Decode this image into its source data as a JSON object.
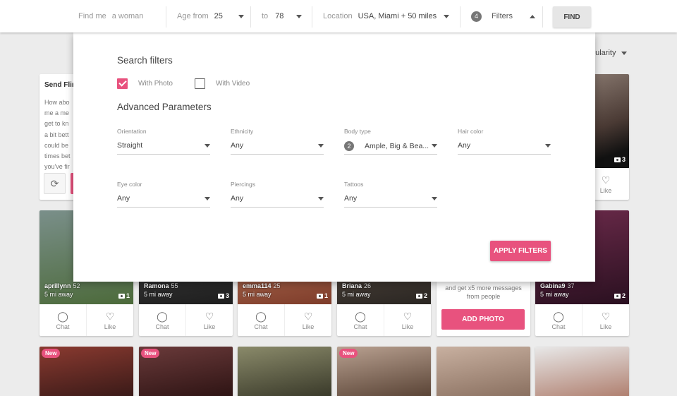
{
  "search": {
    "find_me_label": "Find me",
    "find_me_value": "a woman",
    "age_from_label": "Age from",
    "age_from_value": "25",
    "age_to_label": "to",
    "age_to_value": "78",
    "location_label": "Location",
    "location_value": "USA, Miami + 50 miles",
    "filters_count": "4",
    "filters_label": "Filters",
    "find_button": "FIND"
  },
  "sort": {
    "label": "pularity"
  },
  "flirt_card": {
    "title": "Send Flir",
    "lines": [
      "How abo",
      "me a me",
      "get to kn",
      "a bit bett",
      "could be",
      "times bet",
      "you've fir"
    ],
    "refresh_icon": "⟳"
  },
  "row1_right": {
    "photo_count": "3",
    "like_label": "Like"
  },
  "profiles": [
    {
      "name": "aprillynn",
      "age": "52",
      "distance": "5 mi away",
      "photos": "1",
      "colors": [
        "#7a8f8a",
        "#4c6a3a"
      ]
    },
    {
      "name": "Ramona",
      "age": "55",
      "distance": "5 mi away",
      "photos": "3",
      "colors": [
        "#4a4a4a",
        "#1e1e1e"
      ]
    },
    {
      "name": "emma114",
      "age": "25",
      "distance": "5 mi away",
      "photos": "1",
      "colors": [
        "#c98a6a",
        "#7e3c2a"
      ]
    },
    {
      "name": "Briana",
      "age": "26",
      "distance": "5 mi away",
      "photos": "2",
      "colors": [
        "#6a5a50",
        "#2a2622"
      ]
    },
    {
      "name": "Gabina9",
      "age": "37",
      "distance": "5 mi away",
      "photos": "2",
      "colors": [
        "#6b2a4a",
        "#2a1020"
      ]
    }
  ],
  "promo": {
    "line1": "and get x5 more messages",
    "line2": "from people",
    "button": "ADD PHOTO"
  },
  "actions": {
    "chat": "Chat",
    "like": "Like",
    "chat_icon": "speech-bubble-icon",
    "like_icon": "heart-icon"
  },
  "bottom_row": [
    {
      "new": "New",
      "colors": [
        "#8a3a30",
        "#3a1a18"
      ]
    },
    {
      "new": "New",
      "colors": [
        "#6a3a3a",
        "#2e1414"
      ]
    },
    {
      "new": "",
      "colors": [
        "#8a8a6a",
        "#3a3a2a"
      ]
    },
    {
      "new": "New",
      "colors": [
        "#b8a090",
        "#5a4436"
      ]
    },
    {
      "new": "",
      "colors": [
        "#c8b0a0",
        "#8a7060"
      ]
    },
    {
      "new": "",
      "colors": [
        "#e8e8e8",
        "#b08070"
      ]
    }
  ],
  "modal": {
    "search_filters_heading": "Search filters",
    "with_photo": "With Photo",
    "with_video": "With Video",
    "advanced_heading": "Advanced Parameters",
    "orientation_label": "Orientation",
    "orientation_value": "Straight",
    "ethnicity_label": "Ethnicity",
    "ethnicity_value": "Any",
    "body_type_label": "Body type",
    "body_type_count": "2",
    "body_type_value": "Ample, Big & Bea...",
    "hair_color_label": "Hair color",
    "hair_color_value": "Any",
    "eye_color_label": "Eye color",
    "eye_color_value": "Any",
    "piercings_label": "Piercings",
    "piercings_value": "Any",
    "tattoos_label": "Tattoos",
    "tattoos_value": "Any",
    "apply_button": "APPLY FILTERS"
  },
  "colors": {
    "accent": "#e8527e"
  }
}
